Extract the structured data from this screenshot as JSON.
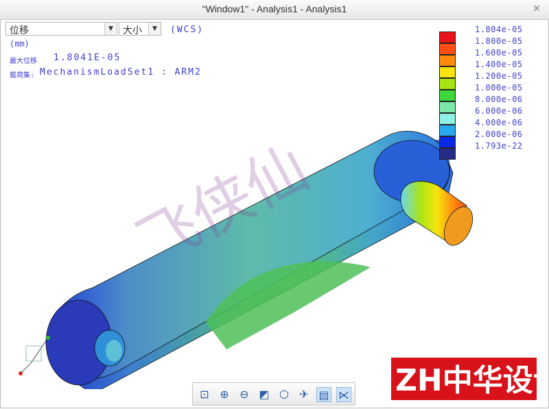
{
  "window": {
    "title": "\"Window1\" - Analysis1 - Analysis1"
  },
  "controls": {
    "quantity": "位移",
    "component": "大小",
    "coord_system": "(WCS)"
  },
  "info": {
    "unit": "(mm)",
    "max_label": "最大位移",
    "max_value": "1.8041E-05",
    "load_label": "载荷集:",
    "load_value": "MechanismLoadSet1 : ARM2"
  },
  "legend": {
    "labels": [
      "1.804e-05",
      "1.800e-05",
      "1.600e-05",
      "1.400e-05",
      "1.200e-05",
      "1.000e-05",
      "8.000e-06",
      "6.000e-06",
      "4.000e-06",
      "2.000e-06",
      "1.793e-22"
    ],
    "colors": [
      "#e8121a",
      "#ff4e12",
      "#ff8a0e",
      "#f7e40e",
      "#a8e414",
      "#3cd83c",
      "#7ce8a8",
      "#8ff0e6",
      "#28a8ee",
      "#0a28e6",
      "#242c88"
    ]
  },
  "toolbar": {
    "buttons": [
      "zoom-fit-icon",
      "zoom-in-icon",
      "zoom-out-icon",
      "refit-icon",
      "view-orient-icon",
      "spin-center-icon",
      "display-style-icon",
      "datum-display-icon"
    ]
  },
  "watermark": {
    "text": "飞侠仙"
  },
  "logo": {
    "text": "ZH中华设计"
  }
}
